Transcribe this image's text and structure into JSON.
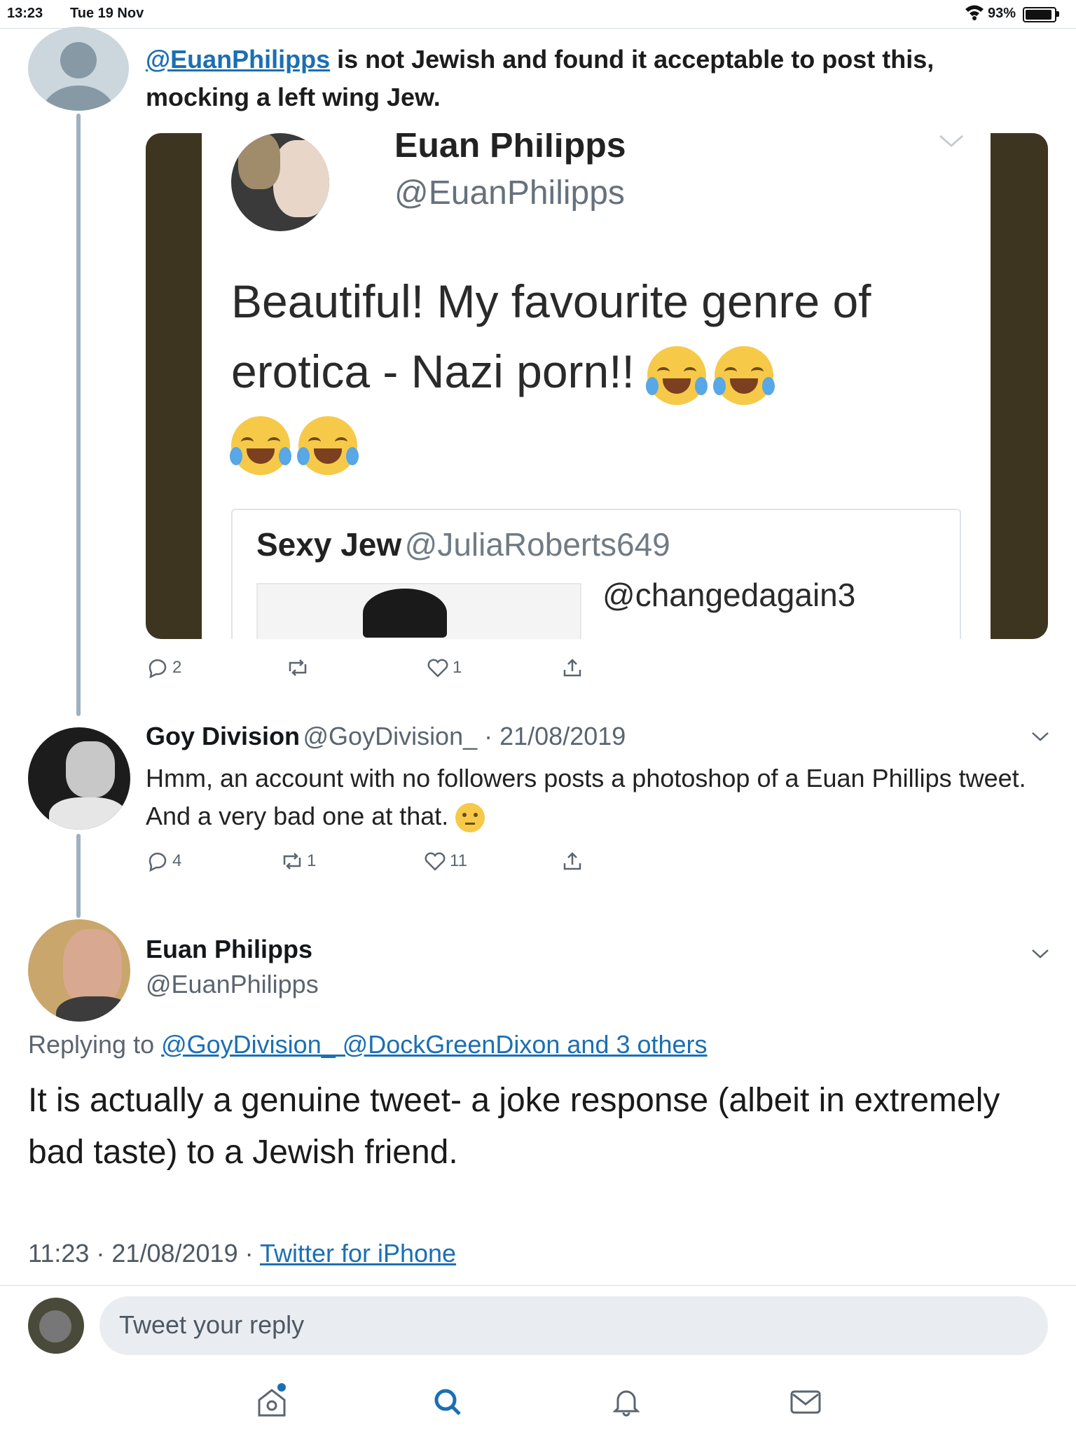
{
  "status_bar": {
    "time": "13:23",
    "date": "Tue 19 Nov",
    "battery": "93%",
    "battery_level": 0.93
  },
  "tweet1": {
    "mention": "@EuanPhilipps",
    "text_rest": " is not Jewish and found it acceptable to post this,",
    "text_line2": "mocking a left wing Jew.",
    "embedded": {
      "name": "Euan Philipps",
      "handle": "@EuanPhilipps",
      "text": "Beautiful! My favourite genre of erotica - Nazi porn!!",
      "quote_name": "Sexy Jew",
      "quote_handle": "@JuliaRoberts649",
      "quote_mention": "@changedagain3"
    },
    "actions": {
      "replies": "2",
      "likes": "1"
    }
  },
  "tweet2": {
    "name": "Goy Division",
    "handle_date": "@GoyDivision_ · 21/08/2019",
    "text": "Hmm, an account with no followers posts a photoshop of a Euan Phillips tweet. And a very bad one at that.",
    "actions": {
      "replies": "4",
      "retweets": "1",
      "likes": "11"
    }
  },
  "tweet3": {
    "name": "Euan Philipps",
    "handle": "@EuanPhilipps",
    "replying_prefix": "Replying to ",
    "replying_links": "@GoyDivision_ @DockGreenDixon and 3 others",
    "text": "It is actually a genuine tweet- a joke response (albeit in extremely bad taste) to a Jewish friend.",
    "timestamp": "11:23 · 21/08/2019 · ",
    "source": "Twitter for iPhone"
  },
  "reply_bar": {
    "placeholder": "Tweet your reply"
  },
  "colors": {
    "accent": "#1b6fb3",
    "embed_frame": "#3e3520"
  },
  "tab_icons": [
    "home-icon",
    "search-icon",
    "notifications-icon",
    "messages-icon"
  ]
}
